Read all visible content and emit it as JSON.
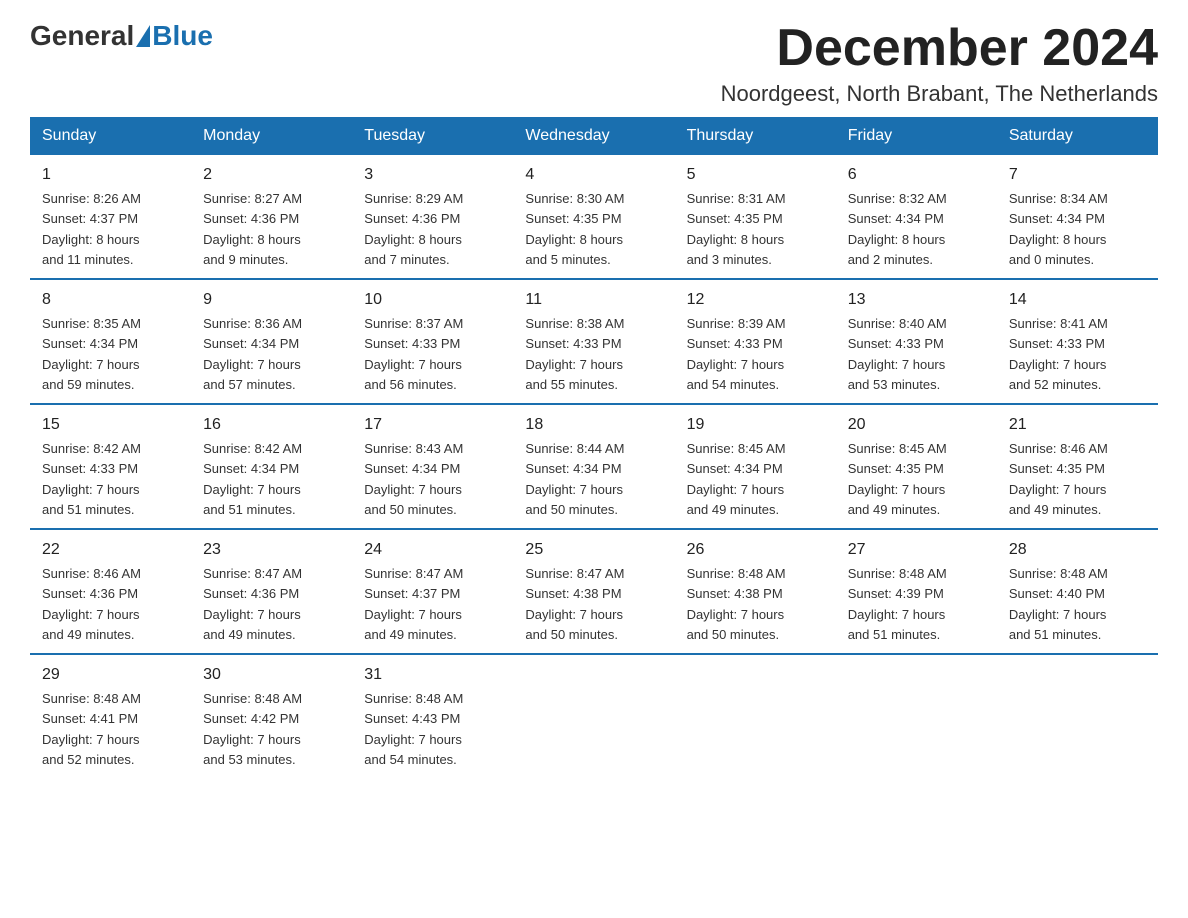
{
  "header": {
    "logo": {
      "general": "General",
      "blue": "Blue"
    },
    "title": "December 2024",
    "location": "Noordgeest, North Brabant, The Netherlands"
  },
  "weekdays": [
    "Sunday",
    "Monday",
    "Tuesday",
    "Wednesday",
    "Thursday",
    "Friday",
    "Saturday"
  ],
  "weeks": [
    [
      {
        "day": "1",
        "sunrise": "8:26 AM",
        "sunset": "4:37 PM",
        "daylight": "8 hours and 11 minutes."
      },
      {
        "day": "2",
        "sunrise": "8:27 AM",
        "sunset": "4:36 PM",
        "daylight": "8 hours and 9 minutes."
      },
      {
        "day": "3",
        "sunrise": "8:29 AM",
        "sunset": "4:36 PM",
        "daylight": "8 hours and 7 minutes."
      },
      {
        "day": "4",
        "sunrise": "8:30 AM",
        "sunset": "4:35 PM",
        "daylight": "8 hours and 5 minutes."
      },
      {
        "day": "5",
        "sunrise": "8:31 AM",
        "sunset": "4:35 PM",
        "daylight": "8 hours and 3 minutes."
      },
      {
        "day": "6",
        "sunrise": "8:32 AM",
        "sunset": "4:34 PM",
        "daylight": "8 hours and 2 minutes."
      },
      {
        "day": "7",
        "sunrise": "8:34 AM",
        "sunset": "4:34 PM",
        "daylight": "8 hours and 0 minutes."
      }
    ],
    [
      {
        "day": "8",
        "sunrise": "8:35 AM",
        "sunset": "4:34 PM",
        "daylight": "7 hours and 59 minutes."
      },
      {
        "day": "9",
        "sunrise": "8:36 AM",
        "sunset": "4:34 PM",
        "daylight": "7 hours and 57 minutes."
      },
      {
        "day": "10",
        "sunrise": "8:37 AM",
        "sunset": "4:33 PM",
        "daylight": "7 hours and 56 minutes."
      },
      {
        "day": "11",
        "sunrise": "8:38 AM",
        "sunset": "4:33 PM",
        "daylight": "7 hours and 55 minutes."
      },
      {
        "day": "12",
        "sunrise": "8:39 AM",
        "sunset": "4:33 PM",
        "daylight": "7 hours and 54 minutes."
      },
      {
        "day": "13",
        "sunrise": "8:40 AM",
        "sunset": "4:33 PM",
        "daylight": "7 hours and 53 minutes."
      },
      {
        "day": "14",
        "sunrise": "8:41 AM",
        "sunset": "4:33 PM",
        "daylight": "7 hours and 52 minutes."
      }
    ],
    [
      {
        "day": "15",
        "sunrise": "8:42 AM",
        "sunset": "4:33 PM",
        "daylight": "7 hours and 51 minutes."
      },
      {
        "day": "16",
        "sunrise": "8:42 AM",
        "sunset": "4:34 PM",
        "daylight": "7 hours and 51 minutes."
      },
      {
        "day": "17",
        "sunrise": "8:43 AM",
        "sunset": "4:34 PM",
        "daylight": "7 hours and 50 minutes."
      },
      {
        "day": "18",
        "sunrise": "8:44 AM",
        "sunset": "4:34 PM",
        "daylight": "7 hours and 50 minutes."
      },
      {
        "day": "19",
        "sunrise": "8:45 AM",
        "sunset": "4:34 PM",
        "daylight": "7 hours and 49 minutes."
      },
      {
        "day": "20",
        "sunrise": "8:45 AM",
        "sunset": "4:35 PM",
        "daylight": "7 hours and 49 minutes."
      },
      {
        "day": "21",
        "sunrise": "8:46 AM",
        "sunset": "4:35 PM",
        "daylight": "7 hours and 49 minutes."
      }
    ],
    [
      {
        "day": "22",
        "sunrise": "8:46 AM",
        "sunset": "4:36 PM",
        "daylight": "7 hours and 49 minutes."
      },
      {
        "day": "23",
        "sunrise": "8:47 AM",
        "sunset": "4:36 PM",
        "daylight": "7 hours and 49 minutes."
      },
      {
        "day": "24",
        "sunrise": "8:47 AM",
        "sunset": "4:37 PM",
        "daylight": "7 hours and 49 minutes."
      },
      {
        "day": "25",
        "sunrise": "8:47 AM",
        "sunset": "4:38 PM",
        "daylight": "7 hours and 50 minutes."
      },
      {
        "day": "26",
        "sunrise": "8:48 AM",
        "sunset": "4:38 PM",
        "daylight": "7 hours and 50 minutes."
      },
      {
        "day": "27",
        "sunrise": "8:48 AM",
        "sunset": "4:39 PM",
        "daylight": "7 hours and 51 minutes."
      },
      {
        "day": "28",
        "sunrise": "8:48 AM",
        "sunset": "4:40 PM",
        "daylight": "7 hours and 51 minutes."
      }
    ],
    [
      {
        "day": "29",
        "sunrise": "8:48 AM",
        "sunset": "4:41 PM",
        "daylight": "7 hours and 52 minutes."
      },
      {
        "day": "30",
        "sunrise": "8:48 AM",
        "sunset": "4:42 PM",
        "daylight": "7 hours and 53 minutes."
      },
      {
        "day": "31",
        "sunrise": "8:48 AM",
        "sunset": "4:43 PM",
        "daylight": "7 hours and 54 minutes."
      },
      null,
      null,
      null,
      null
    ]
  ],
  "labels": {
    "sunrise": "Sunrise:",
    "sunset": "Sunset:",
    "daylight": "Daylight:"
  }
}
